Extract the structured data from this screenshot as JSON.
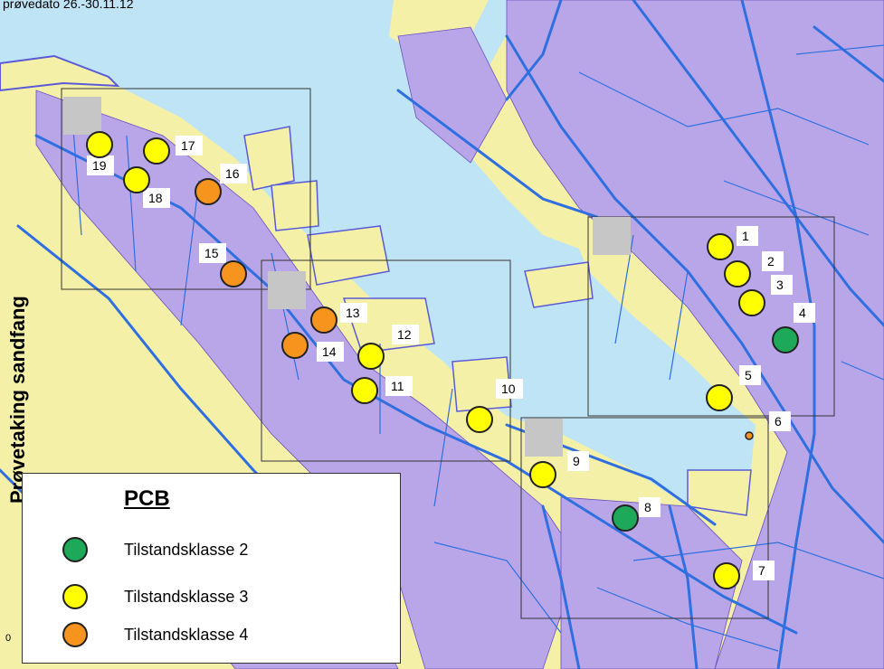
{
  "header": {
    "caption": "prøvedato 26.-30.11.12"
  },
  "side_title": "Prøvetaking sandfang",
  "scale_zero": "0",
  "legend": {
    "title": "PCB",
    "items": [
      {
        "label": "Tilstandsklasse 2",
        "color": "#1ea85a"
      },
      {
        "label": "Tilstandsklasse 3",
        "color": "#ffff00"
      },
      {
        "label": "Tilstandsklasse 4",
        "color": "#f7941d"
      }
    ]
  },
  "stations": [
    {
      "id": "1",
      "class": 3
    },
    {
      "id": "2",
      "class": 3
    },
    {
      "id": "3",
      "class": 3
    },
    {
      "id": "4",
      "class": 2
    },
    {
      "id": "5",
      "class": 3
    },
    {
      "id": "6",
      "class": 4
    },
    {
      "id": "7",
      "class": 3
    },
    {
      "id": "8",
      "class": 2
    },
    {
      "id": "9",
      "class": 3
    },
    {
      "id": "10",
      "class": 3
    },
    {
      "id": "11",
      "class": 3
    },
    {
      "id": "12",
      "class": 3
    },
    {
      "id": "13",
      "class": 4
    },
    {
      "id": "14",
      "class": 4
    },
    {
      "id": "15",
      "class": 4
    },
    {
      "id": "16",
      "class": 4
    },
    {
      "id": "17",
      "class": 3
    },
    {
      "id": "18",
      "class": 3
    },
    {
      "id": "19",
      "class": 3
    }
  ]
}
